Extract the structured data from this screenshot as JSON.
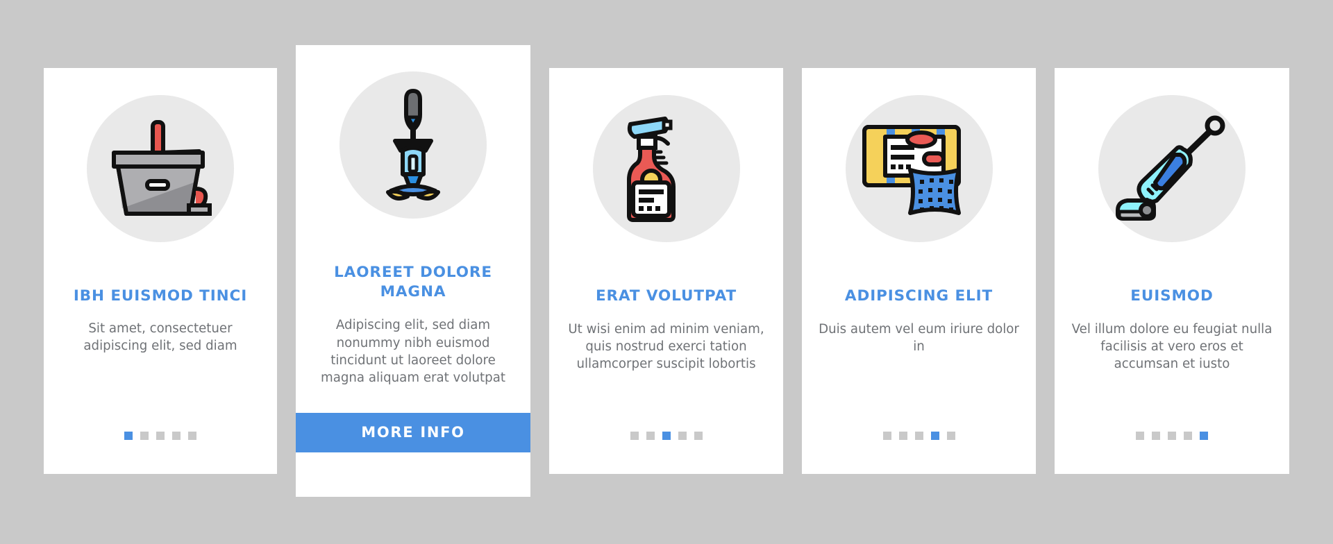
{
  "background_color": "#c9c9c9",
  "accent_color": "#4a90e2",
  "card_color": "#ffffff",
  "icon_circle_color": "#e9e9e9",
  "title_color": "#4a90e2",
  "body_color": "#6f7276",
  "dot_inactive_color": "#c9c9c9",
  "total_steps": 5,
  "cards": [
    {
      "step": 1,
      "icon": "mop-bucket-icon",
      "title": "IBH EUISMOD TINCI",
      "body": "Sit amet, consectetuer adipiscing elit, sed diam",
      "active_dot": 1,
      "has_button": false
    },
    {
      "step": 2,
      "icon": "spin-mop-icon",
      "title": "LAOREET DOLORE MAGNA",
      "body": "Adipiscing elit, sed diam nonummy nibh euismod tincidunt ut laoreet dolore magna aliquam erat volutpat",
      "active_dot": 2,
      "has_button": true,
      "button_label": "MORE INFO"
    },
    {
      "step": 3,
      "icon": "spray-bottle-icon",
      "title": "ERAT VOLUTPAT",
      "body": "Ut wisi enim ad minim veniam, quis nostrud exerci tation ullamcorper suscipit lobortis",
      "active_dot": 3,
      "has_button": false
    },
    {
      "step": 4,
      "icon": "sponge-package-icon",
      "title": "ADIPISCING ELIT",
      "body": "Duis autem vel eum iriure dolor in",
      "active_dot": 4,
      "has_button": false
    },
    {
      "step": 5,
      "icon": "vacuum-cleaner-icon",
      "title": "EUISMOD",
      "body": "Vel illum dolore eu feugiat nulla facilisis at vero eros et accumsan et iusto",
      "active_dot": 5,
      "has_button": false
    }
  ]
}
